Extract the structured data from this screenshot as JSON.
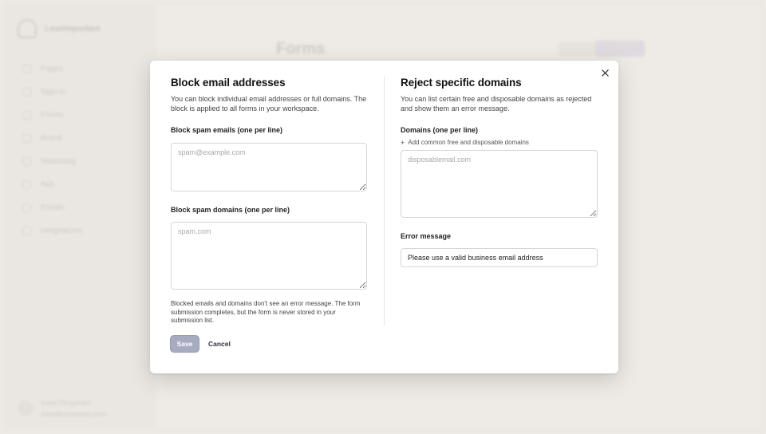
{
  "background": {
    "workspace_name": "LoveImportant",
    "page_title": "Forms",
    "nav_items": [
      "Pages",
      "Sign-in",
      "Forms",
      "Brand",
      "Marketing",
      "Ads",
      "Emails",
      "Integrations"
    ],
    "header_button_1": "Block emails",
    "header_button_2": "New form",
    "user_name": "Kara Fitzgerald",
    "user_email": "kara@company.com"
  },
  "modal": {
    "close_icon": "close-icon",
    "left": {
      "title": "Block email addresses",
      "description": "You can block individual email addresses or full domains. The block is applied to all forms in your workspace.",
      "emails_label": "Block spam emails (one per line)",
      "emails_placeholder": "spam@example.com",
      "domains_label": "Block spam domains (one per line)",
      "domains_placeholder": "spam.com",
      "note": "Blocked emails and domains don't see an error message. The form submission completes, but the form is never stored in your submission list."
    },
    "right": {
      "title": "Reject specific domains",
      "description": "You can list certain free and disposable domains as rejected and show them an error message.",
      "domains_label": "Domains (one per line)",
      "add_link": "Add common free and disposable domains",
      "domains_placeholder": "disposablemail.com",
      "error_label": "Error message",
      "error_value": "Please use a valid business email address"
    },
    "save_label": "Save",
    "cancel_label": "Cancel"
  },
  "colors": {
    "save_button": "#a7abc0",
    "cancel_text": "#2a2f45",
    "backdrop": "#f1eeea"
  }
}
